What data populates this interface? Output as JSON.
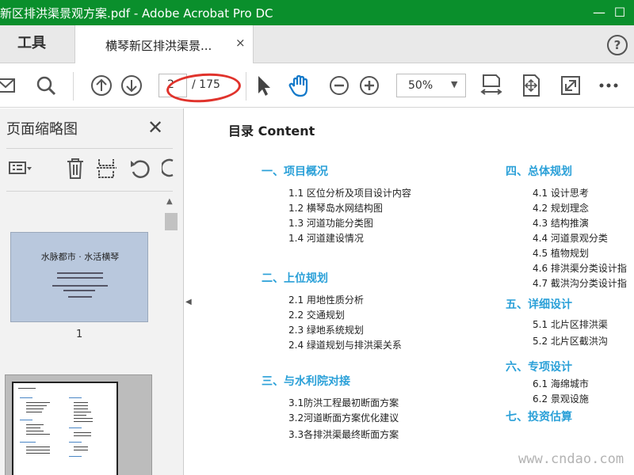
{
  "window": {
    "title": "新区排洪渠景观方案.pdf - Adobe Acrobat Pro DC",
    "minimize_icon": "minimize-icon",
    "maximize_icon": "maximize-icon",
    "tab_tools": "工具",
    "tab_doc": "横琴新区排洪渠景...",
    "tab_close": "×",
    "help": "?"
  },
  "toolbar": {
    "page_current": "2",
    "page_total": "/ 175",
    "zoom": "50%",
    "zoom_arrow": "▼"
  },
  "sidebar": {
    "title": "页面缩略图",
    "close": "✕",
    "thumb1_title": "水脉都市 · 水活横琴",
    "thumb1_number": "1"
  },
  "document": {
    "title": "目录 Content",
    "left_column": [
      {
        "heading": "一、项目概况",
        "items": [
          "1.1 区位分析及项目设计内容",
          "1.2 横琴岛水网结构图",
          "1.3 河道功能分类图",
          "1.4 河道建设情况"
        ]
      },
      {
        "heading": "二、上位规划",
        "items": [
          "2.1  用地性质分析",
          "2.2  交通规划",
          "2.3  绿地系统规划",
          "2.4  绿道规划与排洪渠关系"
        ]
      },
      {
        "heading": "三、与水利院对接",
        "items": [
          "3.1防洪工程最初断面方案",
          "3.2河道断面方案优化建议",
          "3.3各排洪渠最终断面方案"
        ]
      }
    ],
    "right_column": [
      {
        "heading": "四、总体规划",
        "items": [
          "4.1  设计思考",
          "4.2  规划理念",
          "4.3  结构推演",
          "4.4  河道景观分类",
          "4.5  植物规划",
          "4.6  排洪渠分类设计指",
          "4.7  截洪沟分类设计指"
        ]
      },
      {
        "heading": "五、详细设计",
        "items": [
          "5.1  北片区排洪渠",
          "5.2  北片区截洪沟"
        ]
      },
      {
        "heading": "六、专项设计",
        "items": [
          "6.1  海绵城市",
          "6.2  景观设施"
        ]
      },
      {
        "heading": "七、投资估算",
        "items": []
      }
    ]
  },
  "watermark": "www.cndao.com",
  "colors": {
    "titlebar": "#0a8f2c",
    "section_heading": "#2aa0d8",
    "annotation": "#e0332c"
  }
}
